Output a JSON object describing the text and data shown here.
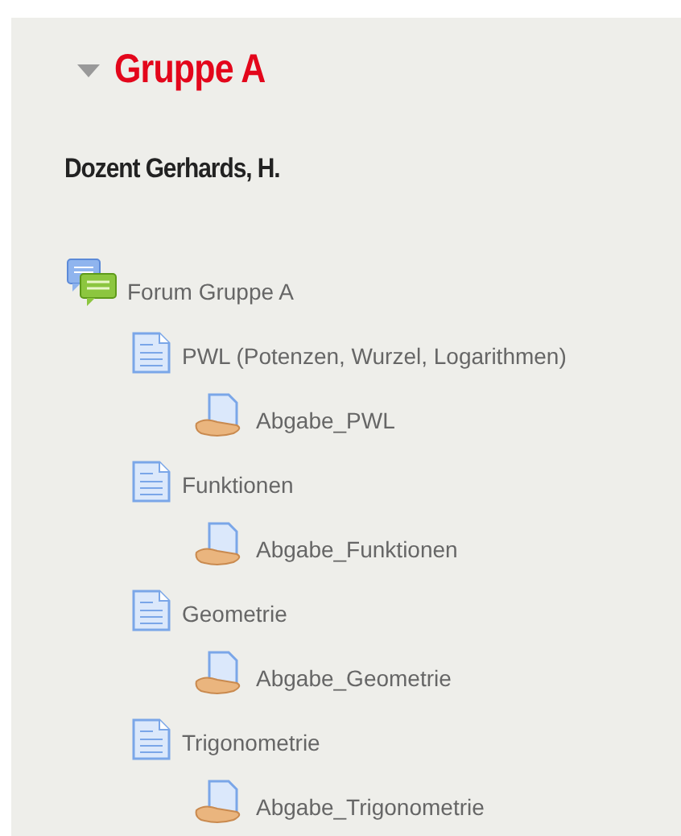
{
  "section": {
    "title": "Gruppe A",
    "expanded": true
  },
  "subheading": "Dozent Gerhards, H.",
  "activities": [
    {
      "kind": "forum",
      "label": "Forum Gruppe A",
      "children": [
        {
          "kind": "page",
          "label": "PWL (Potenzen, Wurzel, Logarithmen)",
          "children": [
            {
              "kind": "assign",
              "label": "Abgabe_PWL"
            }
          ]
        },
        {
          "kind": "page",
          "label": "Funktionen",
          "children": [
            {
              "kind": "assign",
              "label": "Abgabe_Funktionen"
            }
          ]
        },
        {
          "kind": "page",
          "label": "Geometrie",
          "children": [
            {
              "kind": "assign",
              "label": "Abgabe_Geometrie"
            }
          ]
        },
        {
          "kind": "page",
          "label": "Trigonometrie",
          "children": [
            {
              "kind": "assign",
              "label": "Abgabe_Trigonometrie"
            }
          ]
        }
      ]
    }
  ]
}
